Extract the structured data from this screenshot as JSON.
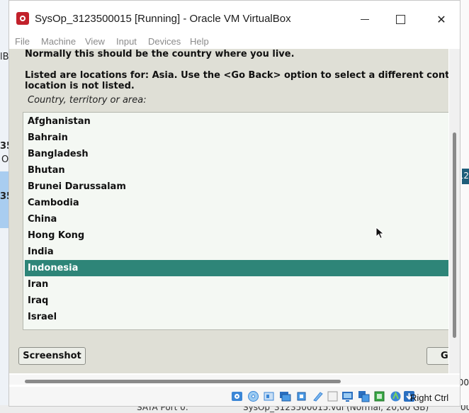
{
  "background": {
    "left_fragments": [
      "lBi",
      "35",
      "O",
      "35"
    ],
    "right_fragment": "12",
    "bottom_left": "SATA Port 0:",
    "bottom_right": "SysOp_3123500015.vdi (Normal, 20,00 GB)",
    "bottom_corner": "00"
  },
  "window": {
    "title": "SysOp_3123500015 [Running] - Oracle VM VirtualBox",
    "controls": {
      "minimize": "",
      "maximize": "",
      "close": "✕"
    }
  },
  "menu": [
    "File",
    "Machine",
    "View",
    "Input",
    "Devices",
    "Help"
  ],
  "installer": {
    "instruction_1": "Normally this should be the country where you live.",
    "instruction_2_line1": "Listed are locations for: Asia. Use the <Go Back> option to select a different continent or region if your",
    "instruction_2_line2": "location is not listed.",
    "prompt": "Country, territory or area:",
    "countries": [
      "Afghanistan",
      "Bahrain",
      "Bangladesh",
      "Bhutan",
      "Brunei Darussalam",
      "Cambodia",
      "China",
      "Hong Kong",
      "India",
      "Indonesia",
      "Iran",
      "Iraq",
      "Israel"
    ],
    "selected_index": 9,
    "screenshot_button": "Screenshot",
    "continue_button": "Go Back"
  },
  "statusbar": {
    "icons": [
      "hard-disk-icon",
      "optical-drive-icon",
      "audio-icon",
      "network-icon",
      "usb-icon",
      "shared-folders-icon",
      "display-icon",
      "video-capture-icon",
      "clipboard-icon",
      "cpu-icon",
      "mouse-integration-icon",
      "keyboard-capture-icon"
    ],
    "host_key": "Right Ctrl"
  },
  "colors": {
    "selection": "#2e8578",
    "installer_bg": "#dfdfd6",
    "list_bg": "#f4f8f3"
  }
}
